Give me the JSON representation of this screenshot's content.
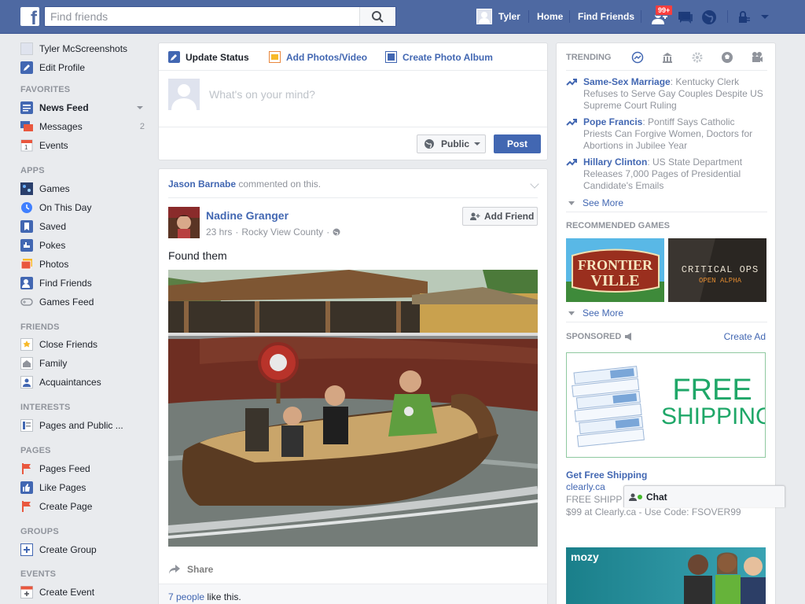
{
  "topbar": {
    "logo": "f",
    "search_placeholder": "Find friends",
    "user_name": "Tyler",
    "home": "Home",
    "find_friends": "Find Friends",
    "friend_requests_badge": "99+"
  },
  "leftnav": {
    "profile_name": "Tyler McScreenshots",
    "edit_profile": "Edit Profile",
    "favorites_head": "FAVORITES",
    "news_feed": "News Feed",
    "messages": "Messages",
    "messages_count": "2",
    "events": "Events",
    "apps_head": "APPS",
    "games": "Games",
    "on_this_day": "On This Day",
    "saved": "Saved",
    "pokes": "Pokes",
    "photos": "Photos",
    "find_friends": "Find Friends",
    "games_feed": "Games Feed",
    "friends_head": "FRIENDS",
    "close_friends": "Close Friends",
    "family": "Family",
    "acquaintances": "Acquaintances",
    "interests_head": "INTERESTS",
    "pages_public": "Pages and Public ...",
    "pages_head": "PAGES",
    "pages_feed": "Pages Feed",
    "like_pages": "Like Pages",
    "create_page": "Create Page",
    "groups_head": "GROUPS",
    "create_group": "Create Group",
    "events_head": "EVENTS",
    "create_event": "Create Event"
  },
  "composer": {
    "tab_status": "Update Status",
    "tab_photos": "Add Photos/Video",
    "tab_album": "Create Photo Album",
    "placeholder": "What's on your mind?",
    "privacy": "Public",
    "post": "Post"
  },
  "post": {
    "story_actor": "Jason Barnabe",
    "story_action": " commented on this.",
    "author": "Nadine Granger",
    "time": "23 hrs",
    "location": "Rocky View County",
    "add_friend": "Add Friend",
    "text": "Found them",
    "share": "Share",
    "likes_people": "7 people",
    "likes_suffix": " like this."
  },
  "right": {
    "trending_head": "TRENDING",
    "trends": [
      {
        "topic": "Same-Sex Marriage",
        "desc": ": Kentucky Clerk Refuses to Serve Gay Couples Despite US Supreme Court Ruling"
      },
      {
        "topic": "Pope Francis",
        "desc": ": Pontiff Says Catholic Priests Can Forgive Women, Doctors for Abortions in Jubilee Year"
      },
      {
        "topic": "Hillary Clinton",
        "desc": ": US State Department Releases 7,000 Pages of Presidential Candidate's Emails"
      }
    ],
    "see_more": "See More",
    "games_head": "RECOMMENDED GAMES",
    "game1_line1": "FRONTIER",
    "game1_line2": "VILLE",
    "game2_line1": "CRITICAL OPS",
    "game2_line2": "OPEN ALPHA",
    "see_more_games": "See More",
    "sponsored_head": "SPONSORED",
    "create_ad": "Create Ad",
    "ad_free_line1": "FREE",
    "ad_free_line2": "SHIPPING",
    "ad_title": "Get Free Shipping",
    "ad_url": "clearly.ca",
    "ad_desc_line1": "FREE SHIPP",
    "ad_desc_line2": "$99 at Clearly.ca - Use Code: FSOVER99",
    "ad2_logo": "mozy"
  },
  "chat": {
    "label": "Chat"
  },
  "colors": {
    "brand_blue": "#4e69a2",
    "link_blue": "#4267b2",
    "badge_red": "#fa3e3e",
    "online_green": "#42b72a"
  }
}
